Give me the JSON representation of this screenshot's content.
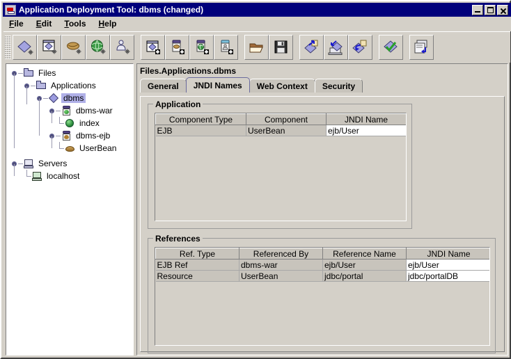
{
  "window": {
    "title": "Application Deployment Tool: dbms (changed)",
    "icon": "app-icon",
    "buttons": {
      "minimize": "minimize-button",
      "maximize": "maximize-button",
      "close": "close-button"
    }
  },
  "menubar": [
    {
      "label": "File",
      "mnemonic": "F"
    },
    {
      "label": "Edit",
      "mnemonic": "E"
    },
    {
      "label": "Tools",
      "mnemonic": "T"
    },
    {
      "label": "Help",
      "mnemonic": "H"
    }
  ],
  "toolbar": {
    "groups": [
      {
        "buttons": [
          {
            "name": "new-application-icon",
            "glyph": "diamond-new"
          },
          {
            "name": "new-application-from-file-icon",
            "glyph": "diamond-boxed"
          },
          {
            "name": "new-ejb-jar-icon",
            "glyph": "bean-new"
          },
          {
            "name": "new-web-component-icon",
            "glyph": "globe-new"
          },
          {
            "name": "new-app-client-icon",
            "glyph": "client-new"
          }
        ]
      },
      {
        "buttons": [
          {
            "name": "add-application-icon",
            "glyph": "diamond-add"
          },
          {
            "name": "add-ejb-jar-icon",
            "glyph": "jar-bean-add"
          },
          {
            "name": "add-web-war-icon",
            "glyph": "jar-globe-add"
          },
          {
            "name": "add-client-jar-icon",
            "glyph": "jar-client-add"
          }
        ]
      },
      {
        "buttons": [
          {
            "name": "open-icon",
            "glyph": "folder-open"
          },
          {
            "name": "save-icon",
            "glyph": "floppy"
          }
        ]
      },
      {
        "buttons": [
          {
            "name": "deploy-icon",
            "glyph": "deploy"
          },
          {
            "name": "deploy-to-server-icon",
            "glyph": "deploy-server"
          },
          {
            "name": "redeploy-icon",
            "glyph": "redeploy"
          }
        ]
      },
      {
        "buttons": [
          {
            "name": "verify-icon",
            "glyph": "verify-check"
          }
        ]
      },
      {
        "buttons": [
          {
            "name": "export-icon",
            "glyph": "export-pages"
          }
        ]
      }
    ]
  },
  "tree": {
    "nodes": [
      {
        "label": "Files",
        "icon": "folder-icon",
        "depth": 0,
        "expanded": true,
        "selected": false
      },
      {
        "label": "Applications",
        "icon": "folder-icon",
        "depth": 1,
        "expanded": true,
        "selected": false
      },
      {
        "label": "dbms",
        "icon": "application-diamond-icon",
        "depth": 2,
        "expanded": true,
        "selected": true
      },
      {
        "label": "dbms-war",
        "icon": "war-jar-icon",
        "depth": 3,
        "expanded": true,
        "selected": false
      },
      {
        "label": "index",
        "icon": "web-component-globe-icon",
        "depth": 4,
        "expanded": false,
        "selected": false
      },
      {
        "label": "dbms-ejb",
        "icon": "ejb-jar-icon",
        "depth": 3,
        "expanded": true,
        "selected": false
      },
      {
        "label": "UserBean",
        "icon": "ejb-bean-icon",
        "depth": 4,
        "expanded": false,
        "selected": false
      },
      {
        "label": "Servers",
        "icon": "servers-icon",
        "depth": 0,
        "expanded": true,
        "selected": false
      },
      {
        "label": "localhost",
        "icon": "server-host-icon",
        "depth": 1,
        "expanded": false,
        "selected": false
      }
    ]
  },
  "main": {
    "breadcrumb": "Files.Applications.dbms",
    "tabs": [
      {
        "label": "General",
        "active": false
      },
      {
        "label": "JNDI Names",
        "active": true
      },
      {
        "label": "Web Context",
        "active": false
      },
      {
        "label": "Security",
        "active": false
      }
    ],
    "application_group": {
      "title": "Application",
      "columns": [
        "Component Type",
        "Component",
        "JNDI Name"
      ],
      "rows": [
        {
          "cells": [
            "EJB",
            "UserBean",
            "ejb/User"
          ],
          "editable": [
            false,
            false,
            true
          ]
        }
      ]
    },
    "references_group": {
      "title": "References",
      "columns": [
        "Ref. Type",
        "Referenced By",
        "Reference Name",
        "JNDI Name"
      ],
      "rows": [
        {
          "cells": [
            "EJB Ref",
            "dbms-war",
            "ejb/User",
            "ejb/User"
          ],
          "editable": [
            false,
            false,
            false,
            true
          ]
        },
        {
          "cells": [
            "Resource",
            "UserBean",
            "jdbc/portal",
            "jdbc/portalDB"
          ],
          "editable": [
            false,
            false,
            false,
            true
          ]
        }
      ]
    }
  },
  "colors": {
    "titlebar": "#00007b",
    "face": "#d4d0c8",
    "selection": "#b0b0e8",
    "tab_active_border": "#6b6b9e",
    "editable_cell": "#ffffff"
  }
}
